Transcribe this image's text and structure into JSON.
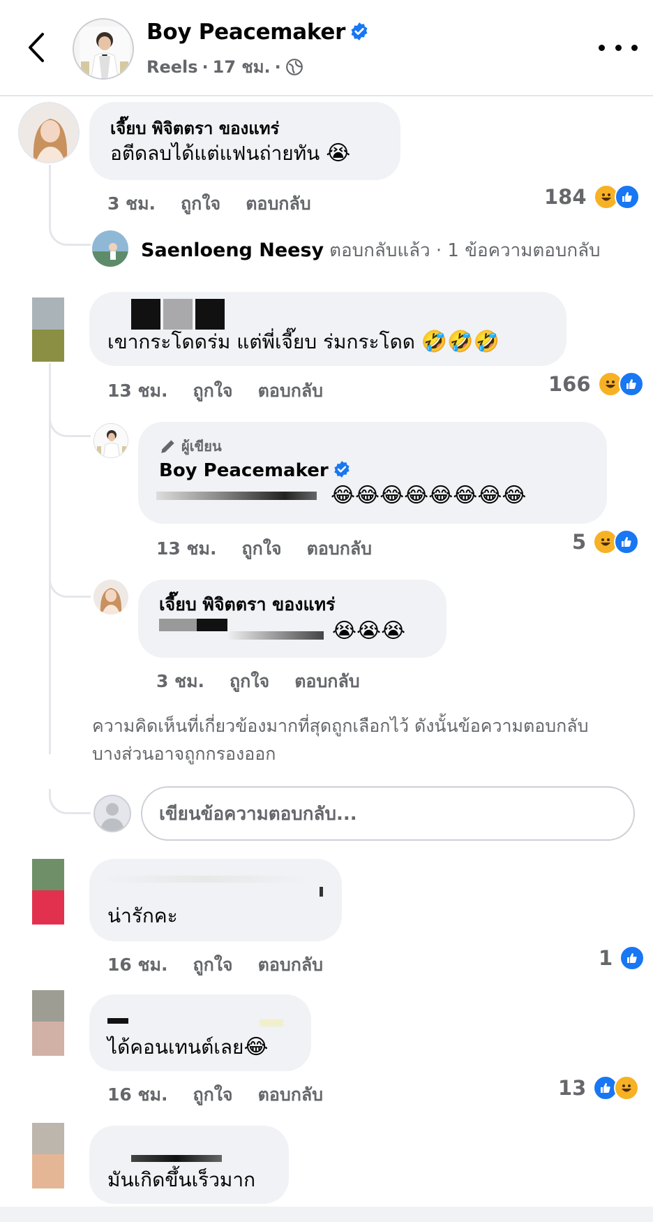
{
  "header": {
    "back_icon": "chevron-left-icon",
    "title": "Boy Peacemaker",
    "subtitle_type": "Reels",
    "subtitle_sep": "·",
    "subtitle_time": "17 ชม.",
    "privacy_icon": "globe-icon",
    "more_icon": "more-horizontal-icon"
  },
  "colors": {
    "accent": "#1877f2",
    "bubble": "#f0f2f5",
    "muted": "#65676b",
    "haha": "#f7b125"
  },
  "comments": [
    {
      "author": "เจี๊ยบ พิจิตตรา ของแทร่",
      "text": "อตีดลบได้แต่แฟนถ่ายทัน",
      "emoji": "😭",
      "time": "3 ชม.",
      "like": "ถูกใจ",
      "reply": "ตอบกลับ",
      "reaction_count": "184",
      "reactions": [
        "haha",
        "like"
      ],
      "reply_summary": {
        "name": "Saenloeng Neesy",
        "action": "ตอบกลับแล้ว",
        "count": "· 1 ข้อความตอบกลับ"
      }
    },
    {
      "author": "",
      "text": "เขากระโดดร่ม แต่พี่เจี๊ยบ ร่มกระโดด",
      "emoji": "🤣🤣🤣",
      "time": "13 ชม.",
      "like": "ถูกใจ",
      "reply": "ตอบกลับ",
      "reaction_count": "166",
      "reactions": [
        "haha",
        "like"
      ],
      "replies": [
        {
          "badge": "ผู้เขียน",
          "author": "Boy Peacemaker",
          "emoji": "😂😂😂😂😂😂😂😂",
          "time": "13 ชม.",
          "like": "ถูกใจ",
          "reply": "ตอบกลับ",
          "reaction_count": "5",
          "reactions": [
            "haha",
            "like"
          ]
        },
        {
          "author": "เจี๊ยบ พิจิตตรา ของแทร่",
          "emoji": "😭😭😭",
          "time": "3 ชม.",
          "like": "ถูกใจ",
          "reply": "ตอบกลับ"
        }
      ],
      "filter_note": "ความคิดเห็นที่เกี่ยวข้องมากที่สุดถูกเลือกไว้ ดังนั้นข้อความตอบกลับบางส่วนอาจถูกกรองออก",
      "reply_placeholder": "เขียนข้อความตอบกลับ..."
    },
    {
      "text": "น่ารักคะ",
      "time": "16 ชม.",
      "like": "ถูกใจ",
      "reply": "ตอบกลับ",
      "reaction_count": "1",
      "reactions": [
        "like"
      ]
    },
    {
      "text": "ได้คอนเทนต์เลย",
      "emoji": "😂",
      "time": "16 ชม.",
      "like": "ถูกใจ",
      "reply": "ตอบกลับ",
      "reaction_count": "13",
      "reactions": [
        "like",
        "haha"
      ]
    },
    {
      "text": "มันเกิดขึ้นเร็วมาก"
    }
  ]
}
